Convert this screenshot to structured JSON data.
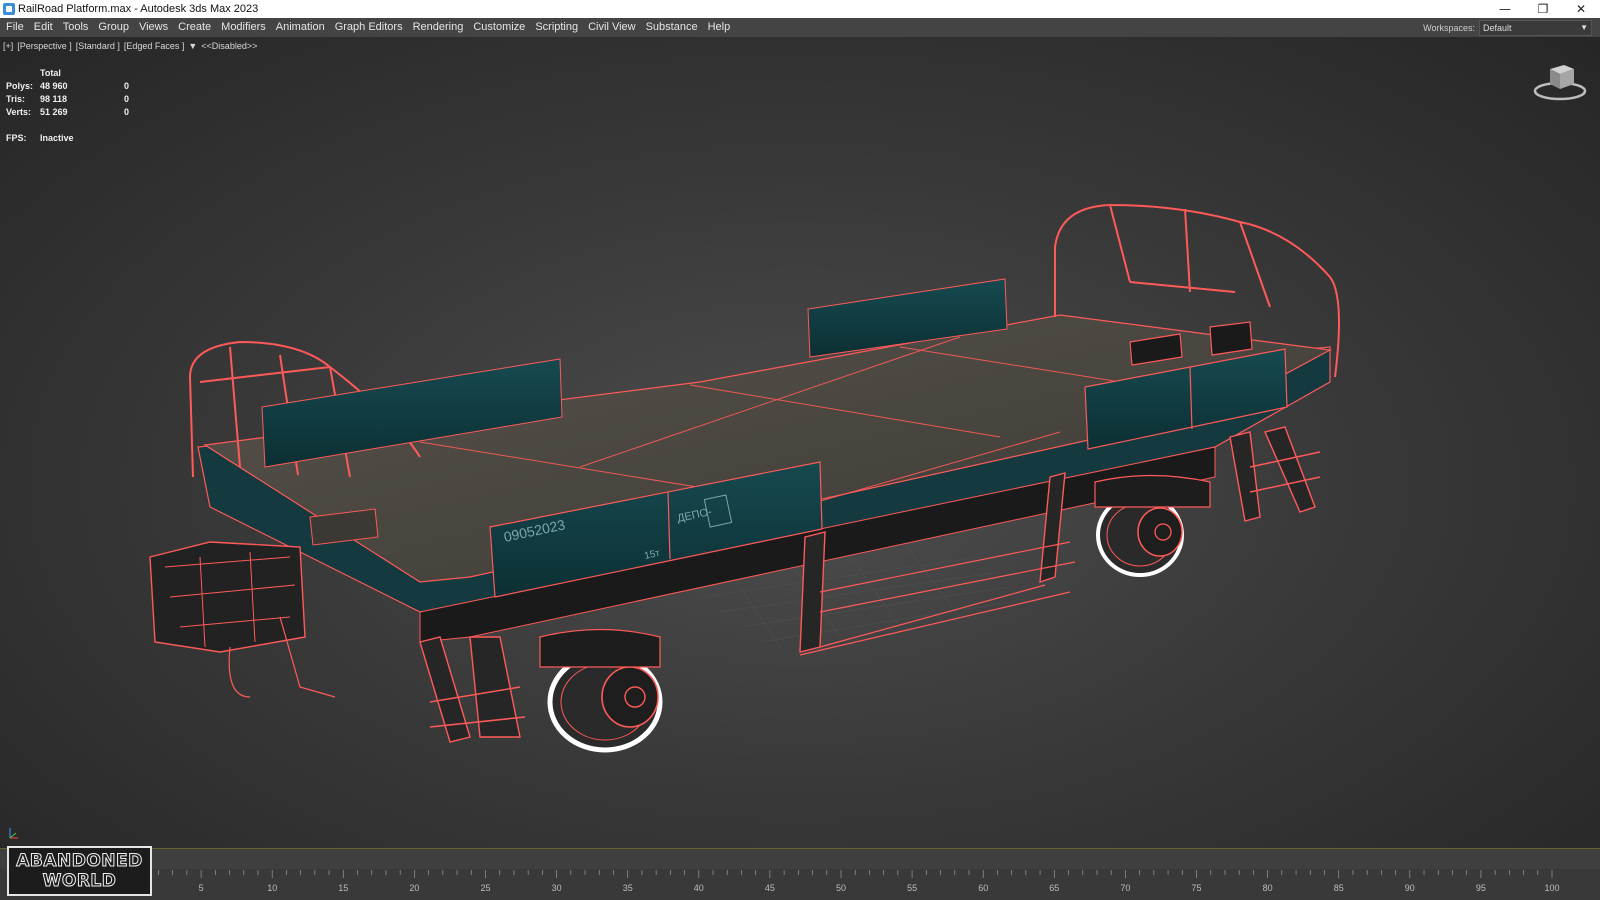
{
  "window": {
    "title": "RailRoad Platform.max - Autodesk 3ds Max 2023",
    "minimize": "—",
    "restore": "❐",
    "close": "✕"
  },
  "menu": {
    "items": [
      "File",
      "Edit",
      "Tools",
      "Group",
      "Views",
      "Create",
      "Modifiers",
      "Animation",
      "Graph Editors",
      "Rendering",
      "Customize",
      "Scripting",
      "Civil View",
      "Substance",
      "Help"
    ],
    "workspaces_label": "Workspaces:",
    "workspace_value": "Default"
  },
  "viewport": {
    "labels": [
      "[+]",
      "[Perspective ]",
      "[Standard ]",
      "[Edged Faces ]",
      "<<Disabled>>"
    ],
    "stats": {
      "header": "Total",
      "rows": [
        {
          "label": "Polys:",
          "total": "48 960",
          "selected": "0"
        },
        {
          "label": "Tris:",
          "total": "98 118",
          "selected": "0"
        },
        {
          "label": "Verts:",
          "total": "51 269",
          "selected": "0"
        }
      ],
      "fps_label": "FPS:",
      "fps_value": "Inactive"
    },
    "decal": {
      "number": "09052023",
      "depot": "ДЕПО-",
      "mark": "15т"
    },
    "colors": {
      "wire": "#ff5a5a",
      "panel": "#0f3a3f",
      "deck": "#4a4640"
    }
  },
  "timeline": {
    "ticks": [
      "5",
      "10",
      "15",
      "20",
      "25",
      "30",
      "35",
      "40",
      "45",
      "50",
      "55",
      "60",
      "65",
      "70",
      "75",
      "80",
      "85",
      "90",
      "95",
      "100"
    ]
  },
  "watermark": {
    "line1": "ABANDONED",
    "line2": "WORLD"
  }
}
